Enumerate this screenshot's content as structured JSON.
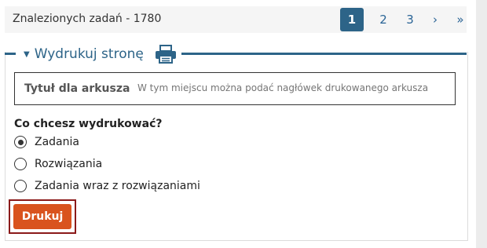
{
  "results": {
    "found_text": "Znalezionych zadań - 1780"
  },
  "pagination": {
    "pages": [
      "1",
      "2",
      "3"
    ],
    "active_page": "1",
    "next": "›",
    "last": "»"
  },
  "print_section": {
    "title": "Wydrukuj stronę",
    "sheet_title": {
      "label": "Tytuł dla arkusza",
      "placeholder": "W tym miejscu można podać nagłówek drukowanego arkusza"
    },
    "question": "Co chcesz wydrukować?",
    "options": [
      {
        "label": "Zadania",
        "checked": true
      },
      {
        "label": "Rozwiązania",
        "checked": false
      },
      {
        "label": "Zadania wraz z rozwiązaniami",
        "checked": false
      }
    ],
    "print_button": "Drukuj"
  },
  "colors": {
    "accent": "#2d6488",
    "button": "#d9531e",
    "highlight_border": "#8b1a1a",
    "placeholder_text": "#7a1a1a"
  },
  "icons": {
    "caret": "caret-down-icon",
    "printer": "printer-icon"
  }
}
